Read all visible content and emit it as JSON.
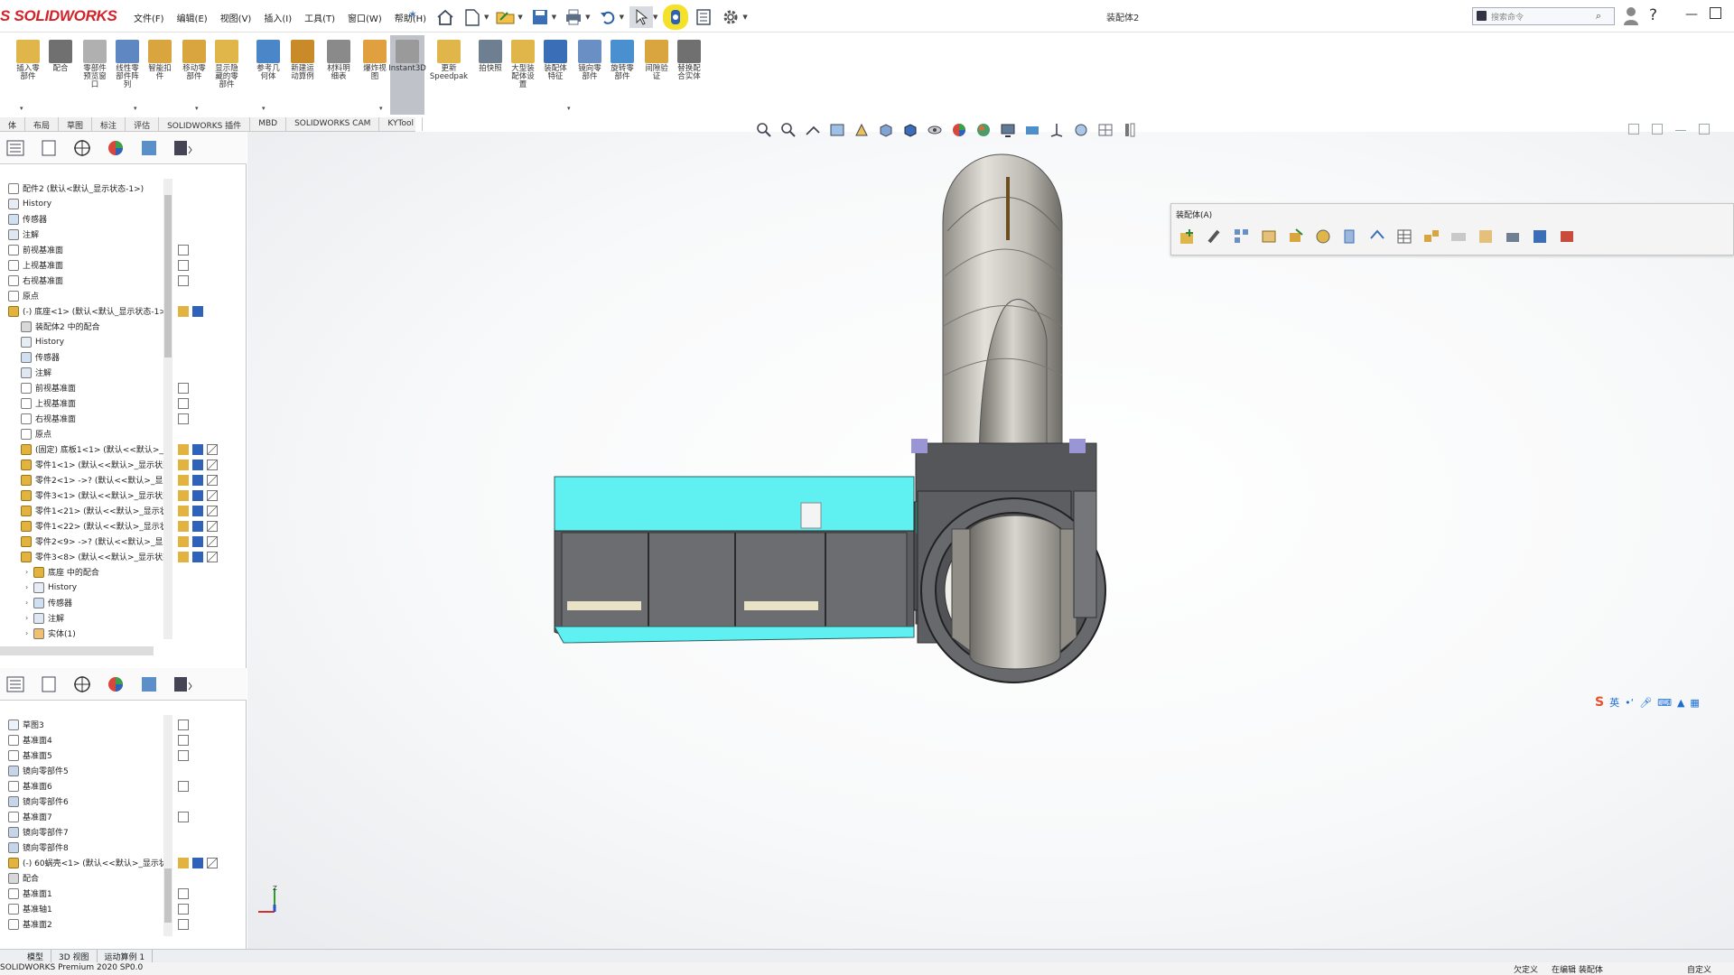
{
  "app": {
    "logo": "S SOLIDWORKS",
    "document_title": "装配体2",
    "status": "SOLIDWORKS Premium 2020 SP0.0"
  },
  "menu": [
    "文件(F)",
    "编辑(E)",
    "视图(V)",
    "插入(I)",
    "工具(T)",
    "窗口(W)",
    "帮助(H)"
  ],
  "search": {
    "placeholder": "搜索命令"
  },
  "commands": [
    {
      "label": "插入零\n部件"
    },
    {
      "label": "配合"
    },
    {
      "label": "零部件\n预览窗\n口"
    },
    {
      "label": "线性零\n部件阵\n列"
    },
    {
      "label": "智能扣\n件"
    },
    {
      "label": "移动零\n部件"
    },
    {
      "label": "显示隐\n藏的零\n部件"
    },
    {
      "label": "参考几\n何体"
    },
    {
      "label": "新建运\n动算例"
    },
    {
      "label": "材料明\n细表"
    },
    {
      "label": "爆炸视\n图"
    },
    {
      "label": "Instant3D"
    },
    {
      "label": "更新\nSpeedpak"
    },
    {
      "label": "拍快照"
    },
    {
      "label": "大型装\n配体设\n置"
    },
    {
      "label": "装配体\n特征"
    },
    {
      "label": "镜向零\n部件"
    },
    {
      "label": "旋转零\n部件"
    },
    {
      "label": "间隙验\n证"
    },
    {
      "label": "替换配\n合实体"
    }
  ],
  "tabs": [
    "体",
    "布局",
    "草图",
    "标注",
    "评估",
    "SOLIDWORKS 插件",
    "MBD",
    "SOLIDWORKS CAM",
    "KYTool"
  ],
  "tree_top": [
    {
      "label": "配件2 (默认<默认_显示状态-1>)",
      "indent": 0
    },
    {
      "label": "History",
      "indent": 0
    },
    {
      "label": "传感器",
      "indent": 0
    },
    {
      "label": "注解",
      "indent": 0
    },
    {
      "label": "前视基准面",
      "indent": 0
    },
    {
      "label": "上视基准面",
      "indent": 0
    },
    {
      "label": "右视基准面",
      "indent": 0
    },
    {
      "label": "原点",
      "indent": 0
    },
    {
      "label": "(-) 底座<1> (默认<默认_显示状态-1>)",
      "indent": 0
    },
    {
      "label": "装配体2 中的配合",
      "indent": 1
    },
    {
      "label": "History",
      "indent": 1
    },
    {
      "label": "传感器",
      "indent": 1
    },
    {
      "label": "注解",
      "indent": 1
    },
    {
      "label": "前视基准面",
      "indent": 1
    },
    {
      "label": "上视基准面",
      "indent": 1
    },
    {
      "label": "右视基准面",
      "indent": 1
    },
    {
      "label": "原点",
      "indent": 1
    },
    {
      "label": "(固定) 底板1<1> (默认<<默认>_显",
      "indent": 1
    },
    {
      "label": "零件1<1> (默认<<默认>_显示状态",
      "indent": 1
    },
    {
      "label": "零件2<1> ->? (默认<<默认>_显示",
      "indent": 1
    },
    {
      "label": "零件3<1> (默认<<默认>_显示状态",
      "indent": 1
    },
    {
      "label": "零件1<21> (默认<<默认>_显示状",
      "indent": 1
    },
    {
      "label": "零件1<22> (默认<<默认>_显示状",
      "indent": 1
    },
    {
      "label": "零件2<9> ->? (默认<<默认>_显示",
      "indent": 1
    },
    {
      "label": "零件3<8> (默认<<默认>_显示状态",
      "indent": 1
    },
    {
      "label": "底座 中的配合",
      "indent": 2
    },
    {
      "label": "History",
      "indent": 2
    },
    {
      "label": "传感器",
      "indent": 2
    },
    {
      "label": "注解",
      "indent": 2
    },
    {
      "label": "实体(1)",
      "indent": 2
    }
  ],
  "tree_bottom": [
    {
      "label": "草图3"
    },
    {
      "label": "基准面4"
    },
    {
      "label": "基准面5"
    },
    {
      "label": "镜向零部件5"
    },
    {
      "label": "基准面6"
    },
    {
      "label": "镜向零部件6"
    },
    {
      "label": "基准面7"
    },
    {
      "label": "镜向零部件7"
    },
    {
      "label": "镜向零部件8"
    },
    {
      "label": "(-) 60蜗壳<1> (默认<<默认>_显示状态"
    },
    {
      "label": "配合"
    },
    {
      "label": "基准面1"
    },
    {
      "label": "基准轴1"
    },
    {
      "label": "基准面2"
    }
  ],
  "floating_toolbar": {
    "title": "装配体(A)"
  },
  "ime": {
    "label": "英"
  },
  "bottom_tabs": [
    "模型",
    "3D 视图",
    "运动算例 1"
  ],
  "status_right": [
    "欠定义",
    "在编辑 装配体",
    "自定义"
  ],
  "colors": {
    "accent": "#3a6fb7",
    "logo_red": "#d2232a",
    "cyan_part": "#5ff0f2",
    "shell_gray": "#b9b7af"
  }
}
